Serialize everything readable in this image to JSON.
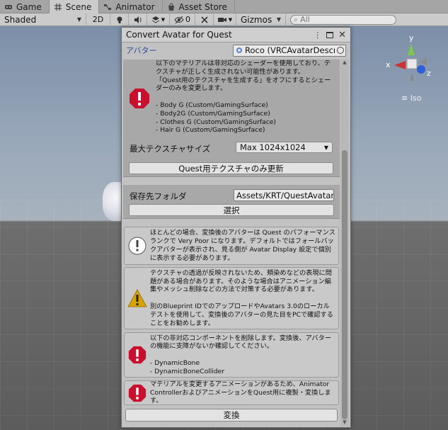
{
  "tabs": [
    {
      "label": "Game",
      "icon": "game-icon"
    },
    {
      "label": "Scene",
      "icon": "scene-icon"
    },
    {
      "label": "Animator",
      "icon": "animator-icon"
    },
    {
      "label": "Asset Store",
      "icon": "asset-store-icon"
    }
  ],
  "toolbar": {
    "shading_mode": "Shaded",
    "mode_2d": "2D",
    "hidden_count": "0",
    "gizmos_label": "Gizmos",
    "search_placeholder": "All"
  },
  "gizmo": {
    "y": "y",
    "x": "x",
    "z": "z",
    "projection": "Iso"
  },
  "dialog": {
    "title": "Convert Avatar for Quest",
    "avatar_label": "アバター",
    "avatar_value": "Roco (VRCAvatarDescriptor)",
    "shader_warning": "以下のマテリアルは非対応のシェーダーを使用しており、テクスチャが正しく生成されない可能性があります。\n「Quest用のテクスチャを生成する」をオフにするとシェーダーのみを変更します。\n\n- Body G (Custom/GamingSurface)\n- Body2G (Custom/GamingSurface)\n- Clothes G (Custom/GamingSurface)\n- Hair G (Custom/GamingSurface)",
    "max_texture_label": "最大テクスチャサイズ",
    "max_texture_value": "Max 1024x1024",
    "update_textures_button": "Quest用テクスチャのみ更新",
    "save_folder_label": "保存先フォルダ",
    "save_folder_value": "Assets/KRT/QuestAvatars",
    "select_button": "選択",
    "info_performance": "ほとんどの場合、変換後のアバターは Quest のパフォーマンスランクで Very Poor になります。デフォルトではフォールバックアバターが表示され、見る側が Avatar Display 設定で個別に表示する必要があります。",
    "warning_transparency": "テクスチャの透過が反映されないため、頬染めなどの表現に問題がある場合があります。そのような場合はアニメーション編集やメッシュ削除などの方法で対策する必要があります。\n\n別のBlueprint IDでのアップロードやAvatars 3.0のローカルテストを使用して、変換後のアバターの見た目をPCで確認することをお勧めします。",
    "error_components": "以下の非対応コンポーネントを削除します。変換後、アバターの機能に支障がないか確認してください。\n\n- DynamicBone\n- DynamicBoneCollider",
    "error_animation": "マテリアルを変更するアニメーションがあるため、Animator ControllerおよびアニメーションをQuest用に複製・変換します。",
    "convert_button": "変換"
  },
  "colors": {
    "error": "#c8102e",
    "warning": "#d9a400",
    "info": "#ffffff",
    "link": "#2a4ea0"
  }
}
